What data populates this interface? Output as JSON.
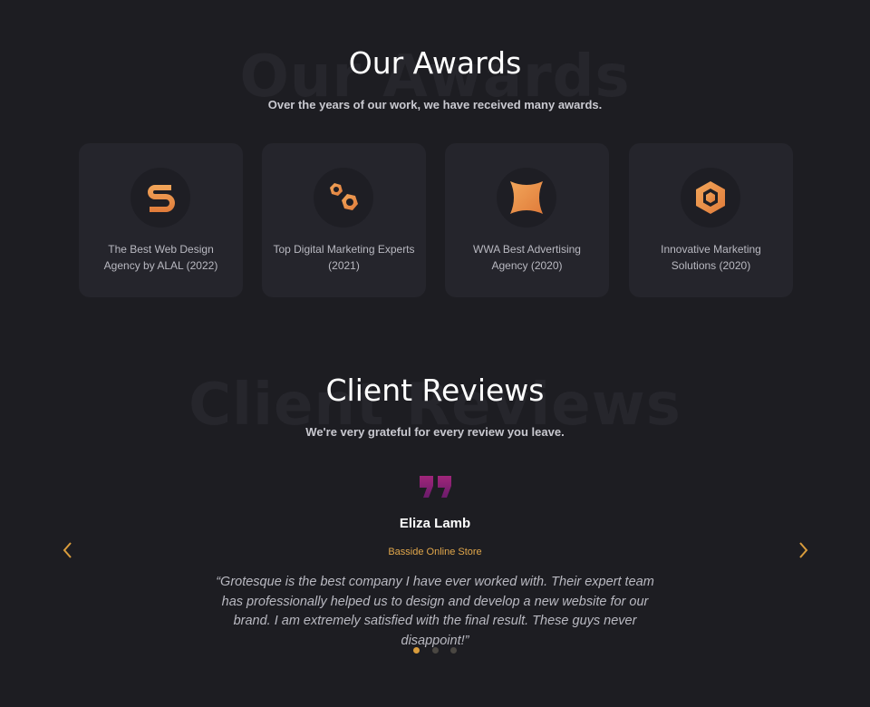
{
  "awards": {
    "ghost_text": "Our Awards",
    "title": "Our Awards",
    "subtitle": "Over the years of our work, we have received many awards.",
    "items": [
      {
        "icon": "s-logo-icon",
        "label": "The Best Web Design Agency by ALAL (2022)"
      },
      {
        "icon": "gears-icon",
        "label": "Top Digital Marketing Experts (2021)"
      },
      {
        "icon": "concave-square-icon",
        "label": "WWA Best Advertising Agency (2020)"
      },
      {
        "icon": "hexagon-icon",
        "label": "Innovative Marketing Solutions (2020)"
      }
    ]
  },
  "reviews": {
    "ghost_text": "Client Reviews",
    "title": "Client Reviews",
    "subtitle": "We're very grateful for every review you leave.",
    "reviewer_name": "Eliza Lamb",
    "reviewer_company": "Basside Online Store",
    "quote": "“Grotesque is the best company I have ever worked with. Their expert team has professionally helped us to design and develop a new website for our brand. I am extremely satisfied with the final result. These guys never disappoint!”",
    "active_slide": 1,
    "slide_count": 3
  },
  "colors": {
    "background": "#1d1d22",
    "card": "#25252c",
    "accent": "#e0a64b",
    "quote_gradient_start": "#a0267a",
    "quote_gradient_end": "#6a1b6b"
  }
}
